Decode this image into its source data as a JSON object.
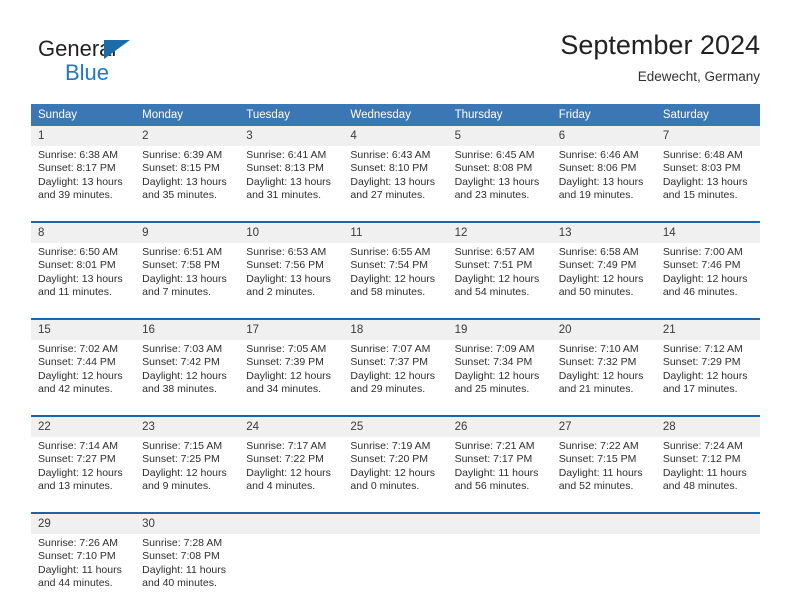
{
  "brand": {
    "name_part1": "General",
    "name_part2": "Blue",
    "triangle_color": "#1b6ca8",
    "blue_color": "#2079c7"
  },
  "header": {
    "month_title": "September 2024",
    "location": "Edewecht, Germany"
  },
  "theme": {
    "header_blue": "#3b77b5",
    "separator_blue": "#1f63a8",
    "daynum_band": "#f0f0f0"
  },
  "weekday_headers": [
    "Sunday",
    "Monday",
    "Tuesday",
    "Wednesday",
    "Thursday",
    "Friday",
    "Saturday"
  ],
  "weeks": [
    {
      "days": [
        {
          "date": "1",
          "sunrise": "Sunrise: 6:38 AM",
          "sunset": "Sunset: 8:17 PM",
          "daylight1": "Daylight: 13 hours",
          "daylight2": "and 39 minutes."
        },
        {
          "date": "2",
          "sunrise": "Sunrise: 6:39 AM",
          "sunset": "Sunset: 8:15 PM",
          "daylight1": "Daylight: 13 hours",
          "daylight2": "and 35 minutes."
        },
        {
          "date": "3",
          "sunrise": "Sunrise: 6:41 AM",
          "sunset": "Sunset: 8:13 PM",
          "daylight1": "Daylight: 13 hours",
          "daylight2": "and 31 minutes."
        },
        {
          "date": "4",
          "sunrise": "Sunrise: 6:43 AM",
          "sunset": "Sunset: 8:10 PM",
          "daylight1": "Daylight: 13 hours",
          "daylight2": "and 27 minutes."
        },
        {
          "date": "5",
          "sunrise": "Sunrise: 6:45 AM",
          "sunset": "Sunset: 8:08 PM",
          "daylight1": "Daylight: 13 hours",
          "daylight2": "and 23 minutes."
        },
        {
          "date": "6",
          "sunrise": "Sunrise: 6:46 AM",
          "sunset": "Sunset: 8:06 PM",
          "daylight1": "Daylight: 13 hours",
          "daylight2": "and 19 minutes."
        },
        {
          "date": "7",
          "sunrise": "Sunrise: 6:48 AM",
          "sunset": "Sunset: 8:03 PM",
          "daylight1": "Daylight: 13 hours",
          "daylight2": "and 15 minutes."
        }
      ]
    },
    {
      "days": [
        {
          "date": "8",
          "sunrise": "Sunrise: 6:50 AM",
          "sunset": "Sunset: 8:01 PM",
          "daylight1": "Daylight: 13 hours",
          "daylight2": "and 11 minutes."
        },
        {
          "date": "9",
          "sunrise": "Sunrise: 6:51 AM",
          "sunset": "Sunset: 7:58 PM",
          "daylight1": "Daylight: 13 hours",
          "daylight2": "and 7 minutes."
        },
        {
          "date": "10",
          "sunrise": "Sunrise: 6:53 AM",
          "sunset": "Sunset: 7:56 PM",
          "daylight1": "Daylight: 13 hours",
          "daylight2": "and 2 minutes."
        },
        {
          "date": "11",
          "sunrise": "Sunrise: 6:55 AM",
          "sunset": "Sunset: 7:54 PM",
          "daylight1": "Daylight: 12 hours",
          "daylight2": "and 58 minutes."
        },
        {
          "date": "12",
          "sunrise": "Sunrise: 6:57 AM",
          "sunset": "Sunset: 7:51 PM",
          "daylight1": "Daylight: 12 hours",
          "daylight2": "and 54 minutes."
        },
        {
          "date": "13",
          "sunrise": "Sunrise: 6:58 AM",
          "sunset": "Sunset: 7:49 PM",
          "daylight1": "Daylight: 12 hours",
          "daylight2": "and 50 minutes."
        },
        {
          "date": "14",
          "sunrise": "Sunrise: 7:00 AM",
          "sunset": "Sunset: 7:46 PM",
          "daylight1": "Daylight: 12 hours",
          "daylight2": "and 46 minutes."
        }
      ]
    },
    {
      "days": [
        {
          "date": "15",
          "sunrise": "Sunrise: 7:02 AM",
          "sunset": "Sunset: 7:44 PM",
          "daylight1": "Daylight: 12 hours",
          "daylight2": "and 42 minutes."
        },
        {
          "date": "16",
          "sunrise": "Sunrise: 7:03 AM",
          "sunset": "Sunset: 7:42 PM",
          "daylight1": "Daylight: 12 hours",
          "daylight2": "and 38 minutes."
        },
        {
          "date": "17",
          "sunrise": "Sunrise: 7:05 AM",
          "sunset": "Sunset: 7:39 PM",
          "daylight1": "Daylight: 12 hours",
          "daylight2": "and 34 minutes."
        },
        {
          "date": "18",
          "sunrise": "Sunrise: 7:07 AM",
          "sunset": "Sunset: 7:37 PM",
          "daylight1": "Daylight: 12 hours",
          "daylight2": "and 29 minutes."
        },
        {
          "date": "19",
          "sunrise": "Sunrise: 7:09 AM",
          "sunset": "Sunset: 7:34 PM",
          "daylight1": "Daylight: 12 hours",
          "daylight2": "and 25 minutes."
        },
        {
          "date": "20",
          "sunrise": "Sunrise: 7:10 AM",
          "sunset": "Sunset: 7:32 PM",
          "daylight1": "Daylight: 12 hours",
          "daylight2": "and 21 minutes."
        },
        {
          "date": "21",
          "sunrise": "Sunrise: 7:12 AM",
          "sunset": "Sunset: 7:29 PM",
          "daylight1": "Daylight: 12 hours",
          "daylight2": "and 17 minutes."
        }
      ]
    },
    {
      "days": [
        {
          "date": "22",
          "sunrise": "Sunrise: 7:14 AM",
          "sunset": "Sunset: 7:27 PM",
          "daylight1": "Daylight: 12 hours",
          "daylight2": "and 13 minutes."
        },
        {
          "date": "23",
          "sunrise": "Sunrise: 7:15 AM",
          "sunset": "Sunset: 7:25 PM",
          "daylight1": "Daylight: 12 hours",
          "daylight2": "and 9 minutes."
        },
        {
          "date": "24",
          "sunrise": "Sunrise: 7:17 AM",
          "sunset": "Sunset: 7:22 PM",
          "daylight1": "Daylight: 12 hours",
          "daylight2": "and 4 minutes."
        },
        {
          "date": "25",
          "sunrise": "Sunrise: 7:19 AM",
          "sunset": "Sunset: 7:20 PM",
          "daylight1": "Daylight: 12 hours",
          "daylight2": "and 0 minutes."
        },
        {
          "date": "26",
          "sunrise": "Sunrise: 7:21 AM",
          "sunset": "Sunset: 7:17 PM",
          "daylight1": "Daylight: 11 hours",
          "daylight2": "and 56 minutes."
        },
        {
          "date": "27",
          "sunrise": "Sunrise: 7:22 AM",
          "sunset": "Sunset: 7:15 PM",
          "daylight1": "Daylight: 11 hours",
          "daylight2": "and 52 minutes."
        },
        {
          "date": "28",
          "sunrise": "Sunrise: 7:24 AM",
          "sunset": "Sunset: 7:12 PM",
          "daylight1": "Daylight: 11 hours",
          "daylight2": "and 48 minutes."
        }
      ]
    },
    {
      "days": [
        {
          "date": "29",
          "sunrise": "Sunrise: 7:26 AM",
          "sunset": "Sunset: 7:10 PM",
          "daylight1": "Daylight: 11 hours",
          "daylight2": "and 44 minutes."
        },
        {
          "date": "30",
          "sunrise": "Sunrise: 7:28 AM",
          "sunset": "Sunset: 7:08 PM",
          "daylight1": "Daylight: 11 hours",
          "daylight2": "and 40 minutes."
        },
        {
          "date": "",
          "sunrise": "",
          "sunset": "",
          "daylight1": "",
          "daylight2": ""
        },
        {
          "date": "",
          "sunrise": "",
          "sunset": "",
          "daylight1": "",
          "daylight2": ""
        },
        {
          "date": "",
          "sunrise": "",
          "sunset": "",
          "daylight1": "",
          "daylight2": ""
        },
        {
          "date": "",
          "sunrise": "",
          "sunset": "",
          "daylight1": "",
          "daylight2": ""
        },
        {
          "date": "",
          "sunrise": "",
          "sunset": "",
          "daylight1": "",
          "daylight2": ""
        }
      ]
    }
  ]
}
